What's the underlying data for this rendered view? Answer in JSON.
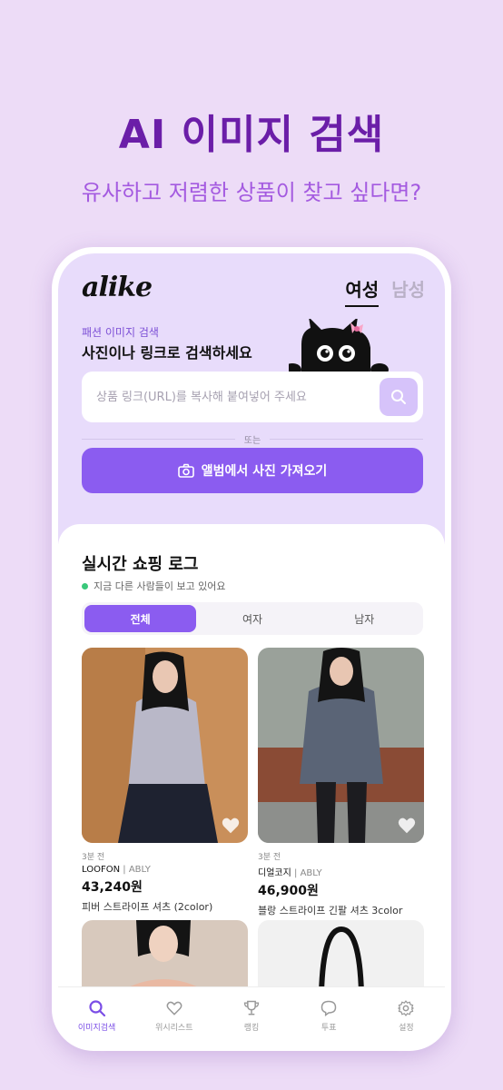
{
  "promo": {
    "title": "AI 이미지 검색",
    "subtitle": "유사하고 저렴한 상품이 찾고 싶다면?"
  },
  "app": {
    "logo": "alike",
    "gender_tabs": [
      {
        "label": "여성",
        "active": true
      },
      {
        "label": "남성",
        "active": false
      }
    ]
  },
  "hero": {
    "kicker": "패션 이미지 검색",
    "heading": "사진이나 링크로 검색하세요",
    "search_placeholder": "상품 링크(URL)를 복사해 붙여넣어 주세요",
    "or_text": "또는",
    "album_button": "앨범에서 사진 가져오기"
  },
  "live": {
    "title": "실시간 쇼핑 로그",
    "subtitle": "지금 다른 사람들이 보고 있어요",
    "filters": [
      {
        "label": "전체",
        "active": true
      },
      {
        "label": "여자",
        "active": false
      },
      {
        "label": "남자",
        "active": false
      }
    ]
  },
  "products": [
    {
      "time": "3분 전",
      "shop": "LOOFON",
      "source": "ABLY",
      "price": "43,240원",
      "name": "피버 스트라이프 셔츠 (2color)"
    },
    {
      "time": "3분 전",
      "shop": "디얼코지",
      "source": "ABLY",
      "price": "46,900원",
      "name": "블랑 스트라이프 긴팔 셔츠 3color"
    }
  ],
  "nav": [
    {
      "label": "이미지검색",
      "icon": "search-icon",
      "active": true
    },
    {
      "label": "위시리스트",
      "icon": "heart-icon",
      "active": false
    },
    {
      "label": "랭킹",
      "icon": "trophy-icon",
      "active": false
    },
    {
      "label": "투표",
      "icon": "chat-icon",
      "active": false
    },
    {
      "label": "설정",
      "icon": "gear-icon",
      "active": false
    }
  ],
  "colors": {
    "background": "#eddcf7",
    "title": "#6b1ea8",
    "subtitle": "#a45ae0",
    "accent": "#8b5cf0",
    "hero_bg": "#e8dcfb"
  }
}
